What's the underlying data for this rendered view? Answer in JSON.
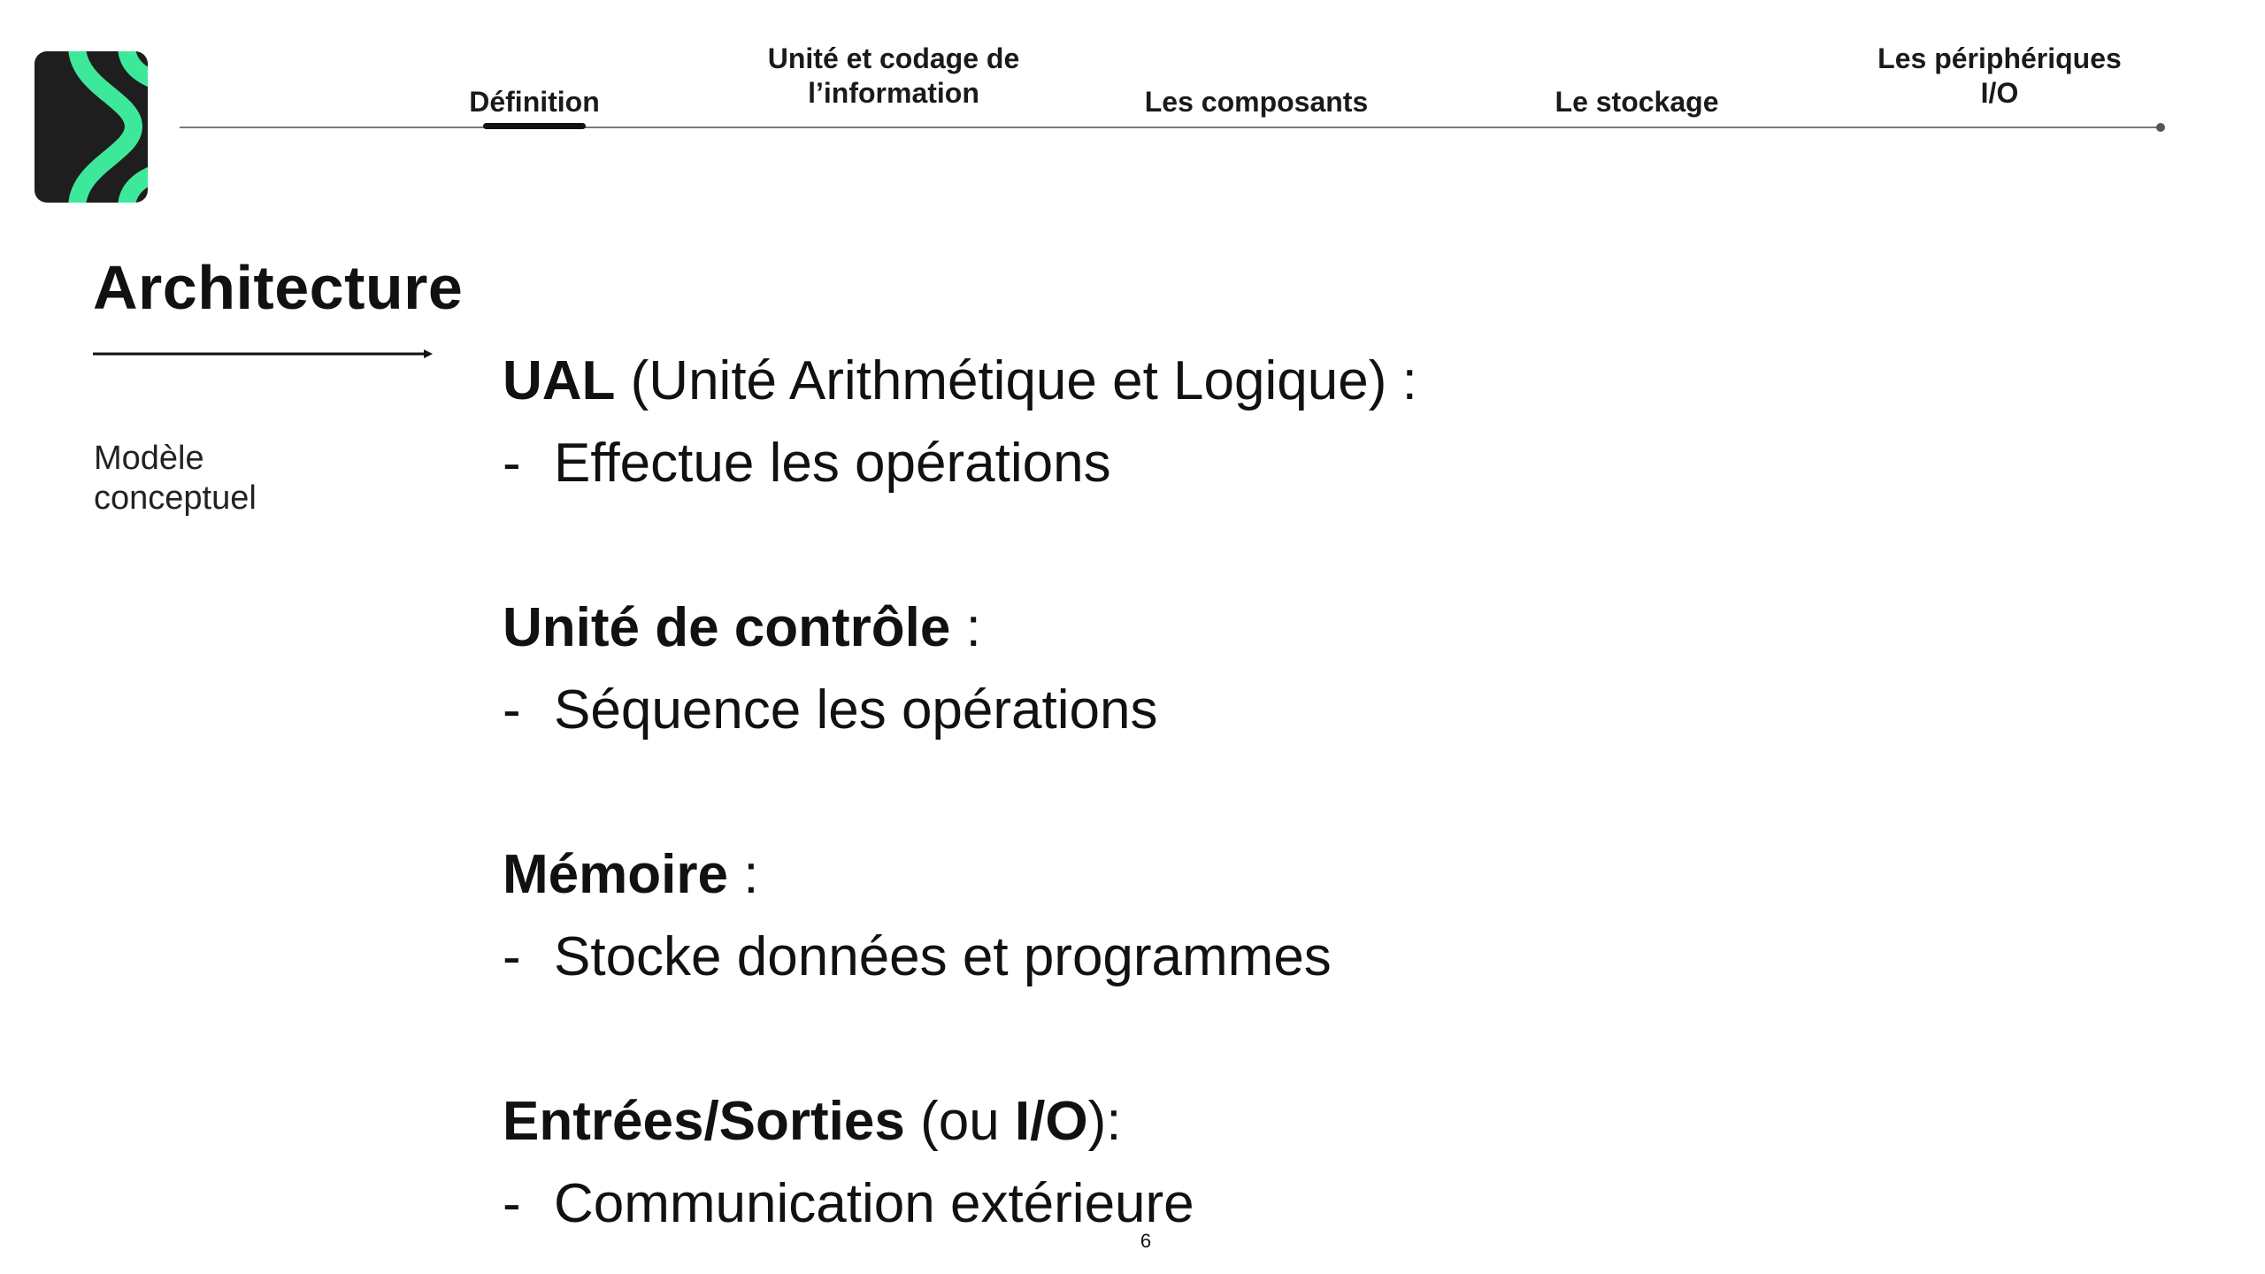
{
  "nav": {
    "items": [
      {
        "label": "Définition",
        "active": true
      },
      {
        "label": "Unité et codage de\nl’information",
        "active": false
      },
      {
        "label": "Les composants",
        "active": false
      },
      {
        "label": "Le stockage",
        "active": false
      },
      {
        "label": "Les périphériques\nI/O",
        "active": false
      }
    ]
  },
  "logo": {
    "icon": "brand-logo-icon",
    "colors": {
      "background": "#1e1e1e",
      "accent": "#3ee89a"
    }
  },
  "title": "Architecture",
  "subtitle": "Modèle\nconceptuel",
  "sections": [
    {
      "heading_bold": "UAL",
      "heading_rest": " (Unité Arithmétique et Logique) :",
      "bullet_dash": "-",
      "bullet": "Effectue les opérations"
    },
    {
      "heading_bold": "Unité de contrôle",
      "heading_rest": " :",
      "bullet_dash": "-",
      "bullet": "Séquence les opérations"
    },
    {
      "heading_bold": "Mémoire",
      "heading_rest": " :",
      "bullet_dash": "-",
      "bullet": "Stocke données et programmes"
    },
    {
      "heading_bold": "Entrées/Sorties",
      "heading_mid": " (ou ",
      "heading_bold2": "I/O",
      "heading_rest": "):",
      "bullet_dash": "-",
      "bullet": "Communication extérieure"
    }
  ],
  "page_number": "6"
}
